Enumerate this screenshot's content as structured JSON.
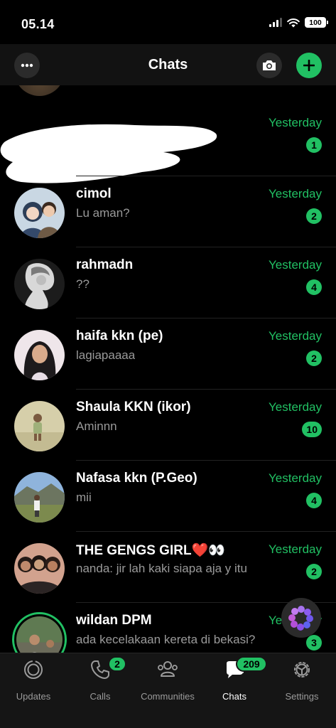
{
  "status_bar": {
    "time": "05.14",
    "battery": "100"
  },
  "header": {
    "title": "Chats",
    "more_icon": "more-horizontal-icon",
    "camera_icon": "camera-icon",
    "new_chat_icon": "plus-icon"
  },
  "colors": {
    "accent": "#21c063",
    "background": "#000000",
    "header": "#121212",
    "preview_text": "#9a9a9a"
  },
  "chats": [
    {
      "name": "",
      "preview": "",
      "time": "Yesterday",
      "unread": "1",
      "redacted": true
    },
    {
      "name": "cimol",
      "preview": "Lu aman?",
      "time": "Yesterday",
      "unread": "2"
    },
    {
      "name": "rahmadn",
      "preview": "??",
      "time": "Yesterday",
      "unread": "4"
    },
    {
      "name": "haifa kkn (pe)",
      "preview": "lagiapaaaa",
      "time": "Yesterday",
      "unread": "2"
    },
    {
      "name": "Shaula KKN (ikor)",
      "preview": "Aminnn",
      "time": "Yesterday",
      "unread": "10"
    },
    {
      "name": "Nafasa kkn (P.Geo)",
      "preview": "mii",
      "time": "Yesterday",
      "unread": "4"
    },
    {
      "name": "THE GENGS GIRL❤️👀",
      "preview": "nanda: jir lah kaki siapa aja y itu",
      "time": "Yesterday",
      "unread": "2"
    },
    {
      "name": "wildan DPM",
      "preview": "ada kecelakaan kereta di bekasi?",
      "time": "Yesterday",
      "unread": "3"
    }
  ],
  "meta_ai_icon": "meta-ai-ring-icon",
  "tabs": [
    {
      "label": "Updates",
      "icon": "updates-icon"
    },
    {
      "label": "Calls",
      "icon": "phone-icon",
      "badge": "2"
    },
    {
      "label": "Communities",
      "icon": "communities-icon"
    },
    {
      "label": "Chats",
      "icon": "chats-icon",
      "badge": "209",
      "active": true
    },
    {
      "label": "Settings",
      "icon": "settings-gear-icon"
    }
  ]
}
